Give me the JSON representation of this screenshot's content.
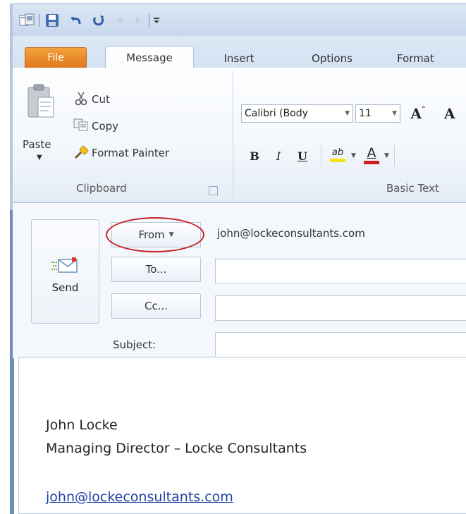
{
  "quick_access": {
    "icons": [
      "window-icon",
      "save-icon",
      "undo-icon",
      "redo-icon",
      "previous-icon",
      "next-icon",
      "customize-icon"
    ]
  },
  "tabs": {
    "file": "File",
    "items": [
      "Message",
      "Insert",
      "Options",
      "Format"
    ]
  },
  "ribbon": {
    "clipboard": {
      "paste": "Paste",
      "cut": "Cut",
      "copy": "Copy",
      "format_painter": "Format Painter",
      "group_label": "Clipboard"
    },
    "basic_text": {
      "font_name": "Calibri (Body",
      "font_size": "11",
      "bold": "B",
      "italic": "I",
      "underline": "U",
      "highlight": "ab",
      "font_color": "A",
      "grow_font": "A",
      "group_label": "Basic Text"
    }
  },
  "header": {
    "send": "Send",
    "from_button": "From",
    "from_value": "john@lockeconsultants.com",
    "to_button": "To...",
    "to_value": "",
    "cc_button": "Cc...",
    "cc_value": "",
    "subject_label": "Subject:",
    "subject_value": ""
  },
  "message_body": {
    "signature_name": "John Locke",
    "signature_title": "Managing Director – Locke Consultants",
    "signature_email": "john@lockeconsultants.com"
  },
  "colors": {
    "file_tab": "#e57f20",
    "highlight_yellow": "#f5e60a",
    "font_red": "#d01f1f",
    "annotation_circle": "#c8202a",
    "link": "#1f3fa8"
  }
}
